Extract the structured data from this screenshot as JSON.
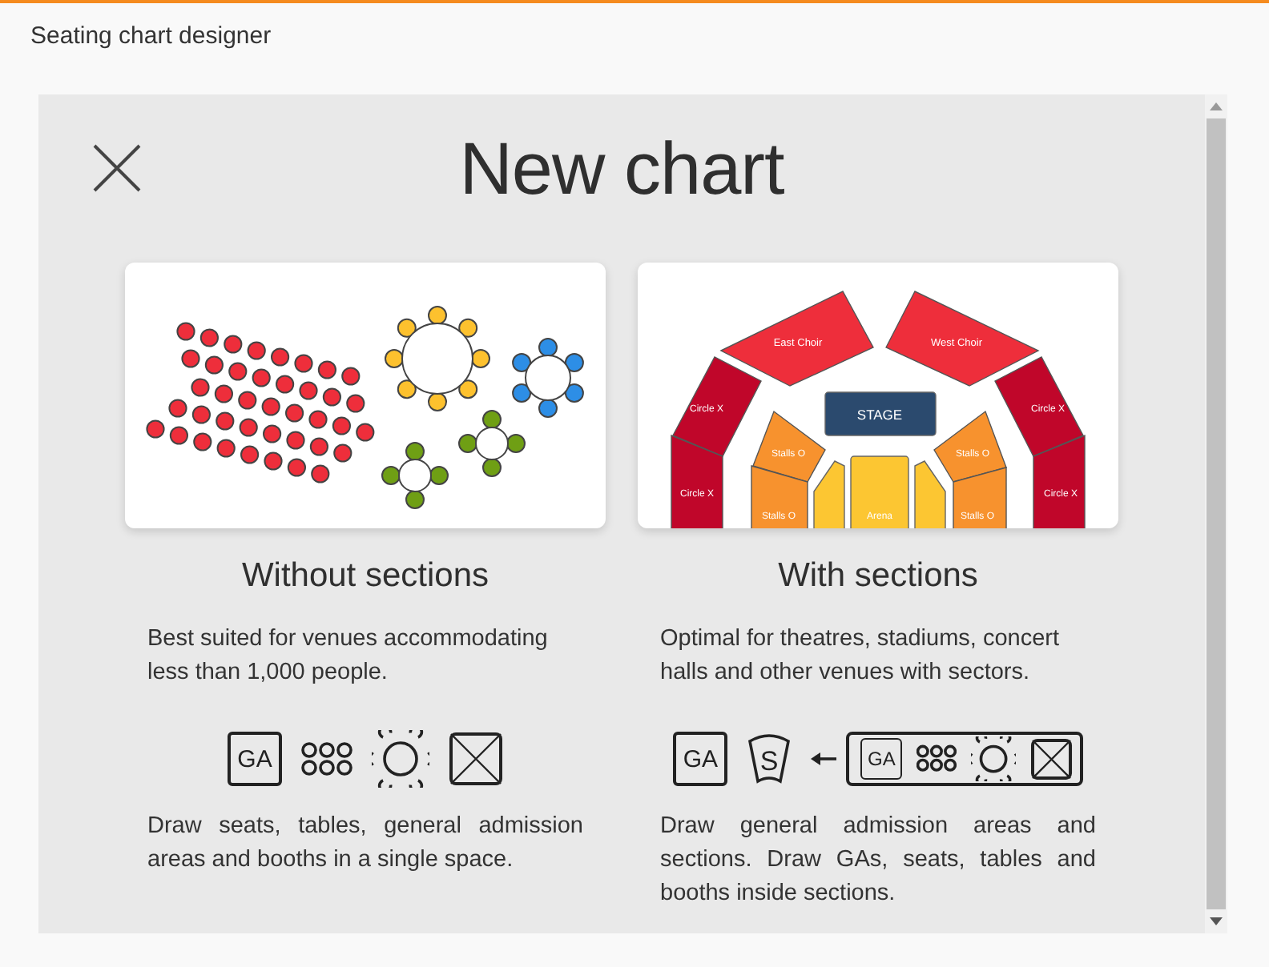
{
  "header": {
    "title": "Seating chart designer"
  },
  "dialog": {
    "title": "New chart",
    "options": [
      {
        "kind": "plain",
        "title": "Without sections",
        "description": "Best suited for venues accommodating less than 1,000 people.",
        "tools": [
          {
            "kind": "ga",
            "label": "GA"
          },
          {
            "kind": "seats"
          },
          {
            "kind": "table"
          },
          {
            "kind": "booth"
          }
        ],
        "details": "Draw seats, tables, general admission areas and booths in a single space."
      },
      {
        "kind": "sections",
        "title": "With sections",
        "description": "Optimal for theatres, stadiums, concert halls and other venues with sectors.",
        "map_labels": [
          {
            "kind": "choir",
            "label": "East Choir"
          },
          {
            "kind": "choir",
            "label": "West Choir"
          },
          {
            "kind": "circle",
            "label": "Circle X"
          },
          {
            "kind": "circle",
            "label": "Circle X"
          },
          {
            "kind": "stage",
            "label": "STAGE"
          },
          {
            "kind": "stalls",
            "label": "Stalls O"
          },
          {
            "kind": "stalls",
            "label": "Stalls O"
          },
          {
            "kind": "circle",
            "label": "Circle X"
          },
          {
            "kind": "circle",
            "label": "Circle X"
          },
          {
            "kind": "stalls",
            "label": "Stalls O"
          },
          {
            "kind": "arena",
            "label": "Arena"
          },
          {
            "kind": "stalls",
            "label": "Stalls O"
          }
        ],
        "tools": [
          {
            "kind": "ga",
            "label": "GA"
          },
          {
            "kind": "section",
            "label": "S"
          },
          {
            "kind": "arrow"
          },
          {
            "kind": "group",
            "children": [
              {
                "kind": "ga",
                "label": "GA"
              },
              {
                "kind": "seats"
              },
              {
                "kind": "table"
              },
              {
                "kind": "booth"
              }
            ]
          }
        ],
        "details": "Draw general admission areas and sections. Draw GAs, seats, tables and booths inside sections."
      }
    ]
  }
}
